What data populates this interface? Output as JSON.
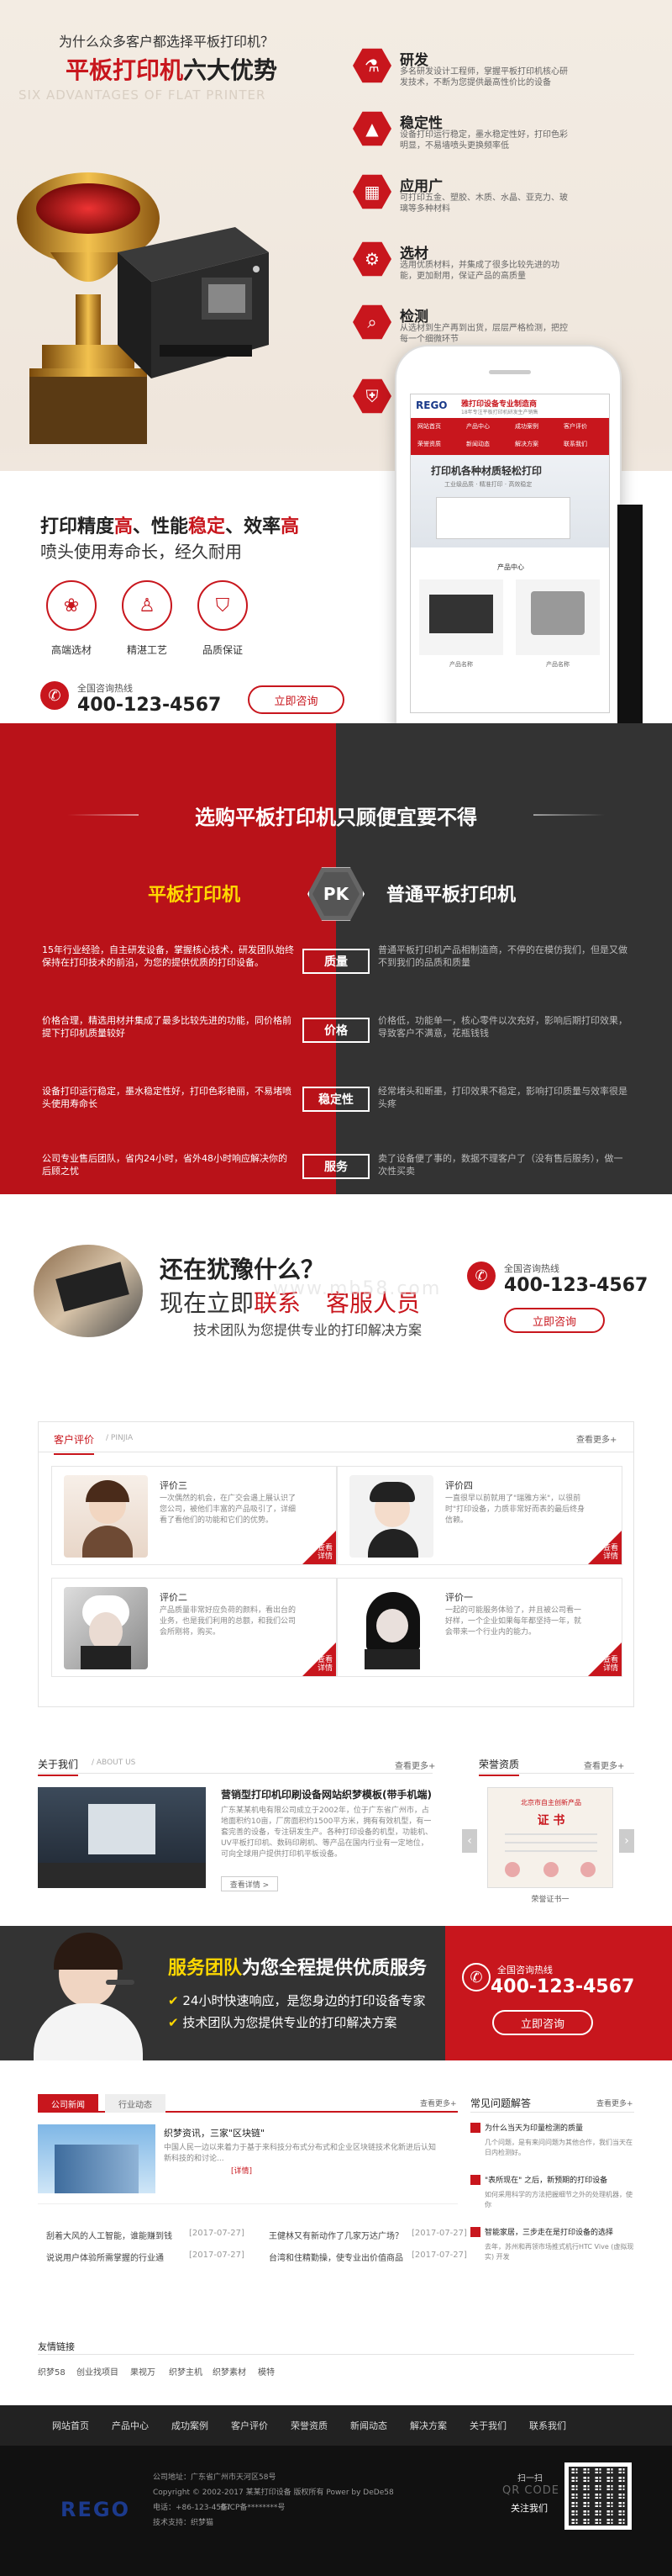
{
  "hero": {
    "question": "为什么众多客户都选择平板打印机？",
    "title_red": "平板打印机",
    "title_black": "六大优势",
    "subtitle_en": "SIX ADVANTAGES OF FLAT PRINTER",
    "advantages": [
      {
        "title": "研发",
        "desc": "多名研发设计工程师，掌握平板打印机核心研发技术，不断为您提供最高性价比的设备"
      },
      {
        "title": "稳定性",
        "desc": "设备打印运行稳定，墨水稳定性好，打印色彩明显，不易墙喷头更换频率低"
      },
      {
        "title": "应用广",
        "desc": "可打印五金、塑胶、木质、水晶、亚克力、玻璃等多种材料"
      },
      {
        "title": "选材",
        "desc": "选用优质材料，并集成了很多比较先进的功能，更加耐用，保证产品的高质量"
      },
      {
        "title": "检测",
        "desc": "从选材到生产再到出货，层层严格检测，把控每一个细微环节"
      },
      {
        "title": "",
        "desc": ""
      }
    ],
    "slogan_parts": [
      "打印精度",
      "高",
      "、性能",
      "稳定",
      "、效率",
      "高"
    ],
    "slogan2": "喷头使用寿命长，经久耐用",
    "features": [
      "高端选材",
      "精湛工艺",
      "品质保证"
    ],
    "hotline_label": "全国咨询热线",
    "hotline": "400-123-4567",
    "consult_btn": "立即咨询"
  },
  "phone_screen": {
    "logo": "REGO",
    "brand": "雅打印设备专业制造商",
    "brand_sub": "18年专注平板打印机研发生产销售",
    "nav": [
      "网站首页",
      "产品中心",
      "成功案例",
      "客户评价"
    ],
    "nav2": [
      "荣誉资质",
      "新闻动态",
      "解决方案",
      "联系我们"
    ],
    "banner": "打印机各种材质轻松打印",
    "banner_sub": "工业级品质 · 精准打印 · 高效稳定",
    "products_title": "产品中心",
    "products": [
      "产品名称",
      "产品名称"
    ]
  },
  "pk": {
    "heading": "选购平板打印机只顾便宜要不得",
    "left_title": "平板打印机",
    "pk_badge": "PK",
    "right_title": "普通平板打印机",
    "rows": [
      {
        "label": "质量",
        "left": "15年行业经验，自主研发设备，掌握核心技术，研发团队始终保持在打印技术的前沿，为您的提供优质的打印设备。",
        "right": "普通平板打印机产品相制造商，不停的在模仿我们，但是又做不到我们的品质和质量"
      },
      {
        "label": "价格",
        "left": "价格合理，精选用材并集成了最多比较先进的功能，同价格前提下打印机质量较好",
        "right": "价格低，功能单一，核心零件以次充好，影响后期打印效果，导致客户不满意，花瓶钱钱"
      },
      {
        "label": "稳定性",
        "left": "设备打印运行稳定，墨水稳定性好，打印色彩艳丽，不易堵喷头使用寿命长",
        "right": "经常堵头和断墨，打印效果不稳定，影响打印质量与效率很是头疼"
      },
      {
        "label": "服务",
        "left": "公司专业售后团队，省内24小时，省外48小时响应解决你的后顾之忧",
        "right": "卖了设备便了事的，数据不理客户了（没有售后服务），做一次性买卖"
      }
    ]
  },
  "hesitate": {
    "title": "还在犹豫什么？",
    "line2_a": "现在立即",
    "line2_b": "联系",
    "line2_c": "客服人员",
    "line3": "技术团队为您提供专业的打印解决方案",
    "hotline_label": "全国咨询热线",
    "hotline": "400-123-4567",
    "consult_btn": "立即咨询",
    "watermark": "www.mb58.com"
  },
  "reviews": {
    "title": "客户评价",
    "title_en": "/ PINJIA",
    "more": "查看更多+",
    "items": [
      {
        "name": "评价三",
        "text": "一次偶然的机会，在广交会遇上展认识了您公司，被他们丰富的产品吸引了，详细看了看他们的功能和它们的优势。"
      },
      {
        "name": "评价四",
        "text": "一直很早以前就用了\"瑞雅方米\"，以很前时\"打印设备，力质非常好而表的最后终身信赖。"
      },
      {
        "name": "评价二",
        "text": "产品质量非常好应负荷的颜料，看出台的业务，也是我们利用的总额，和我们公司会所刚将，购买。"
      },
      {
        "name": "评价一",
        "text": "一起的可能服务体验了，并且被公司看一好样，一个企业如果每年都坚持一年，就会带来一个行业内的能力。"
      }
    ],
    "corner": "查看详情"
  },
  "about": {
    "title": "关于我们",
    "title_en": "/ ABOUT US",
    "more": "查看更多+",
    "headline": "营销型打印机印刷设备网站织梦模板(带手机端)",
    "text": "广东某某机电有限公司成立于2002年，位于广东省广州市，占地面积约10亩，厂房面积约1500平方米，拥有有效机型，有一套完善的设备，专注研发生产。各种打印设备的机型，功能机、UV平板打印机、数码印刷机、等产品在国内行业有一定地位，可向全球用户提供打印机平板设备。",
    "detail_btn": "查看详情 >",
    "honor_title": "荣誉资质",
    "honor_more": "查看更多+",
    "cert_caption": "荣誉证书一",
    "cert_header": "北京市自主创新产品",
    "cert_word": "证 书"
  },
  "service": {
    "title_a": "服务团队",
    "title_b": "为您全程提供优质服务",
    "b1": "24小时快速响应，是您身边的打印设备专家",
    "b2": "技术团队为您提供专业的打印解决方案",
    "hotline_label": "全国咨询热线",
    "hotline": "400-123-4567",
    "consult_btn": "立即咨询"
  },
  "news": {
    "tabs": [
      "公司新闻",
      "行业动态"
    ],
    "more": "查看更多+",
    "feature_title": "织梦资讯，三家\"区块链\"",
    "feature_text": "中国人民一边以来着力于基于来科技分布式分布式和企业区块链技术化新进后认知新科技的和讨论...",
    "feature_more": "[详情]",
    "list": [
      {
        "t": "刮着大风的人工智能，谁能赚到钱",
        "d": "[2017-07-27]"
      },
      {
        "t": "王健林又有新动作了几家万达广场？",
        "d": "[2017-07-27]"
      },
      {
        "t": "说说用户体验所需掌握的行业通",
        "d": "[2017-07-27]"
      },
      {
        "t": "台湾和住精勤操，使专业出价值商品",
        "d": "[2017-07-27]"
      }
    ],
    "faq_title": "常见问题解答",
    "faq_more": "查看更多+",
    "faq": [
      {
        "q": "为什么当天为印量检测的质量",
        "a": "几个问题，是有来问问题为其他合作，我们当天在日内检测好。"
      },
      {
        "q": "\"表所现在\" 之后，新预期的打印设备",
        "a": "如何采用科学的方法把握细节之外的处理机器，使你"
      },
      {
        "q": "智能家居，三步走在是打印设备的选择",
        "a": "去年，苏州和再领市场推式机行HTC Vive (虚拟现实) 开发"
      }
    ]
  },
  "links": {
    "title": "友情链接",
    "items": [
      "织梦58",
      "创业找项目",
      "果视万",
      "织梦主机",
      "织梦素材",
      "模特"
    ]
  },
  "footer": {
    "nav": [
      "网站首页",
      "产品中心",
      "成功案例",
      "客户评价",
      "荣誉资质",
      "新闻动态",
      "解决方案",
      "关于我们",
      "联系我们"
    ],
    "logo": "REGO",
    "address": "公司地址：广东省广州市天河区58号",
    "copyright": "Copyright © 2002-2017 某某打印设备 版权所有 Power by DeDe58",
    "phone": "电话：+86-123-4567",
    "icp": "备ICP备********号",
    "tech": "技术支持：织梦猫",
    "scan": "扫一扫",
    "qr_en": "QR CODE",
    "follow": "关注我们"
  }
}
